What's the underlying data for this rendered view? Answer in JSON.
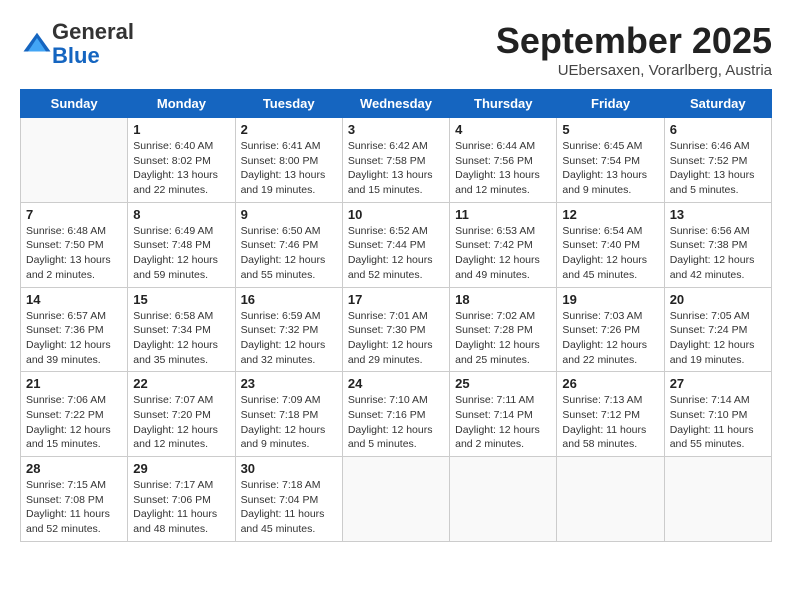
{
  "header": {
    "logo_line1": "General",
    "logo_line2": "Blue",
    "month": "September 2025",
    "location": "UEbersaxen, Vorarlberg, Austria"
  },
  "days_of_week": [
    "Sunday",
    "Monday",
    "Tuesday",
    "Wednesday",
    "Thursday",
    "Friday",
    "Saturday"
  ],
  "weeks": [
    [
      {
        "day": "",
        "sunrise": "",
        "sunset": "",
        "daylight": ""
      },
      {
        "day": "1",
        "sunrise": "Sunrise: 6:40 AM",
        "sunset": "Sunset: 8:02 PM",
        "daylight": "Daylight: 13 hours and 22 minutes."
      },
      {
        "day": "2",
        "sunrise": "Sunrise: 6:41 AM",
        "sunset": "Sunset: 8:00 PM",
        "daylight": "Daylight: 13 hours and 19 minutes."
      },
      {
        "day": "3",
        "sunrise": "Sunrise: 6:42 AM",
        "sunset": "Sunset: 7:58 PM",
        "daylight": "Daylight: 13 hours and 15 minutes."
      },
      {
        "day": "4",
        "sunrise": "Sunrise: 6:44 AM",
        "sunset": "Sunset: 7:56 PM",
        "daylight": "Daylight: 13 hours and 12 minutes."
      },
      {
        "day": "5",
        "sunrise": "Sunrise: 6:45 AM",
        "sunset": "Sunset: 7:54 PM",
        "daylight": "Daylight: 13 hours and 9 minutes."
      },
      {
        "day": "6",
        "sunrise": "Sunrise: 6:46 AM",
        "sunset": "Sunset: 7:52 PM",
        "daylight": "Daylight: 13 hours and 5 minutes."
      }
    ],
    [
      {
        "day": "7",
        "sunrise": "Sunrise: 6:48 AM",
        "sunset": "Sunset: 7:50 PM",
        "daylight": "Daylight: 13 hours and 2 minutes."
      },
      {
        "day": "8",
        "sunrise": "Sunrise: 6:49 AM",
        "sunset": "Sunset: 7:48 PM",
        "daylight": "Daylight: 12 hours and 59 minutes."
      },
      {
        "day": "9",
        "sunrise": "Sunrise: 6:50 AM",
        "sunset": "Sunset: 7:46 PM",
        "daylight": "Daylight: 12 hours and 55 minutes."
      },
      {
        "day": "10",
        "sunrise": "Sunrise: 6:52 AM",
        "sunset": "Sunset: 7:44 PM",
        "daylight": "Daylight: 12 hours and 52 minutes."
      },
      {
        "day": "11",
        "sunrise": "Sunrise: 6:53 AM",
        "sunset": "Sunset: 7:42 PM",
        "daylight": "Daylight: 12 hours and 49 minutes."
      },
      {
        "day": "12",
        "sunrise": "Sunrise: 6:54 AM",
        "sunset": "Sunset: 7:40 PM",
        "daylight": "Daylight: 12 hours and 45 minutes."
      },
      {
        "day": "13",
        "sunrise": "Sunrise: 6:56 AM",
        "sunset": "Sunset: 7:38 PM",
        "daylight": "Daylight: 12 hours and 42 minutes."
      }
    ],
    [
      {
        "day": "14",
        "sunrise": "Sunrise: 6:57 AM",
        "sunset": "Sunset: 7:36 PM",
        "daylight": "Daylight: 12 hours and 39 minutes."
      },
      {
        "day": "15",
        "sunrise": "Sunrise: 6:58 AM",
        "sunset": "Sunset: 7:34 PM",
        "daylight": "Daylight: 12 hours and 35 minutes."
      },
      {
        "day": "16",
        "sunrise": "Sunrise: 6:59 AM",
        "sunset": "Sunset: 7:32 PM",
        "daylight": "Daylight: 12 hours and 32 minutes."
      },
      {
        "day": "17",
        "sunrise": "Sunrise: 7:01 AM",
        "sunset": "Sunset: 7:30 PM",
        "daylight": "Daylight: 12 hours and 29 minutes."
      },
      {
        "day": "18",
        "sunrise": "Sunrise: 7:02 AM",
        "sunset": "Sunset: 7:28 PM",
        "daylight": "Daylight: 12 hours and 25 minutes."
      },
      {
        "day": "19",
        "sunrise": "Sunrise: 7:03 AM",
        "sunset": "Sunset: 7:26 PM",
        "daylight": "Daylight: 12 hours and 22 minutes."
      },
      {
        "day": "20",
        "sunrise": "Sunrise: 7:05 AM",
        "sunset": "Sunset: 7:24 PM",
        "daylight": "Daylight: 12 hours and 19 minutes."
      }
    ],
    [
      {
        "day": "21",
        "sunrise": "Sunrise: 7:06 AM",
        "sunset": "Sunset: 7:22 PM",
        "daylight": "Daylight: 12 hours and 15 minutes."
      },
      {
        "day": "22",
        "sunrise": "Sunrise: 7:07 AM",
        "sunset": "Sunset: 7:20 PM",
        "daylight": "Daylight: 12 hours and 12 minutes."
      },
      {
        "day": "23",
        "sunrise": "Sunrise: 7:09 AM",
        "sunset": "Sunset: 7:18 PM",
        "daylight": "Daylight: 12 hours and 9 minutes."
      },
      {
        "day": "24",
        "sunrise": "Sunrise: 7:10 AM",
        "sunset": "Sunset: 7:16 PM",
        "daylight": "Daylight: 12 hours and 5 minutes."
      },
      {
        "day": "25",
        "sunrise": "Sunrise: 7:11 AM",
        "sunset": "Sunset: 7:14 PM",
        "daylight": "Daylight: 12 hours and 2 minutes."
      },
      {
        "day": "26",
        "sunrise": "Sunrise: 7:13 AM",
        "sunset": "Sunset: 7:12 PM",
        "daylight": "Daylight: 11 hours and 58 minutes."
      },
      {
        "day": "27",
        "sunrise": "Sunrise: 7:14 AM",
        "sunset": "Sunset: 7:10 PM",
        "daylight": "Daylight: 11 hours and 55 minutes."
      }
    ],
    [
      {
        "day": "28",
        "sunrise": "Sunrise: 7:15 AM",
        "sunset": "Sunset: 7:08 PM",
        "daylight": "Daylight: 11 hours and 52 minutes."
      },
      {
        "day": "29",
        "sunrise": "Sunrise: 7:17 AM",
        "sunset": "Sunset: 7:06 PM",
        "daylight": "Daylight: 11 hours and 48 minutes."
      },
      {
        "day": "30",
        "sunrise": "Sunrise: 7:18 AM",
        "sunset": "Sunset: 7:04 PM",
        "daylight": "Daylight: 11 hours and 45 minutes."
      },
      {
        "day": "",
        "sunrise": "",
        "sunset": "",
        "daylight": ""
      },
      {
        "day": "",
        "sunrise": "",
        "sunset": "",
        "daylight": ""
      },
      {
        "day": "",
        "sunrise": "",
        "sunset": "",
        "daylight": ""
      },
      {
        "day": "",
        "sunrise": "",
        "sunset": "",
        "daylight": ""
      }
    ]
  ]
}
